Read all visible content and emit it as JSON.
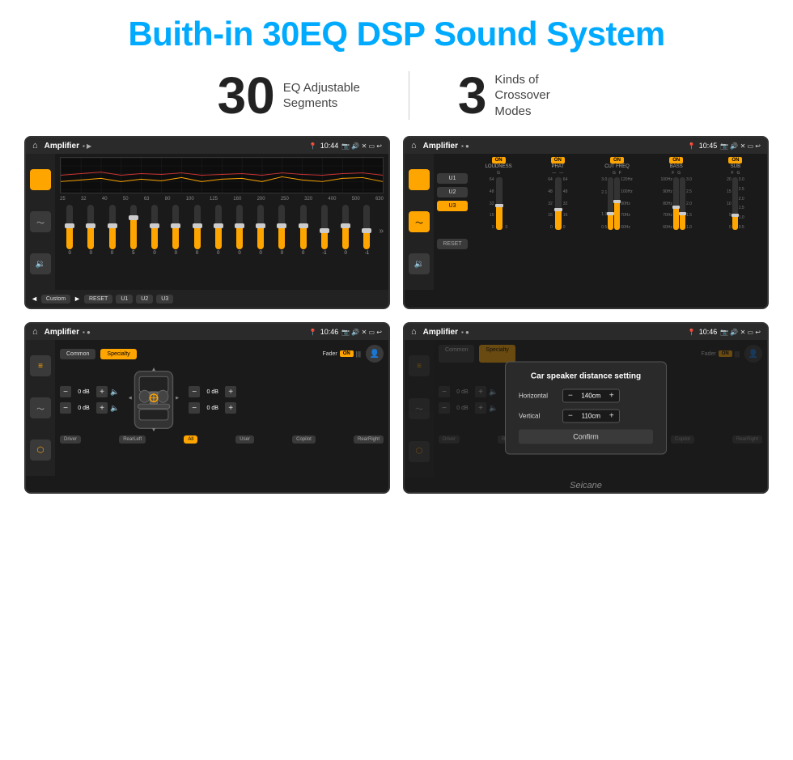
{
  "header": {
    "title": "Buith-in 30EQ DSP Sound System"
  },
  "stats": [
    {
      "number": "30",
      "label": "EQ Adjustable\nSegments"
    },
    {
      "number": "3",
      "label": "Kinds of\nCrossover Modes"
    }
  ],
  "screen1": {
    "status": {
      "title": "Amplifier",
      "time": "10:44"
    },
    "freqs": [
      "25",
      "32",
      "40",
      "50",
      "63",
      "80",
      "100",
      "125",
      "160",
      "200",
      "250",
      "320",
      "400",
      "500",
      "630"
    ],
    "vals": [
      "0",
      "0",
      "0",
      "5",
      "0",
      "0",
      "0",
      "0",
      "0",
      "0",
      "0",
      "0",
      "-1",
      "0",
      "-1"
    ],
    "sliderHeights": [
      50,
      50,
      50,
      60,
      50,
      50,
      50,
      50,
      50,
      50,
      50,
      50,
      42,
      50,
      42
    ],
    "thumbPositions": [
      50,
      50,
      50,
      40,
      50,
      50,
      50,
      50,
      50,
      50,
      50,
      50,
      56,
      50,
      56
    ],
    "buttons": [
      "Custom",
      "RESET",
      "U1",
      "U2",
      "U3"
    ]
  },
  "screen2": {
    "status": {
      "title": "Amplifier",
      "time": "10:45"
    },
    "presets": [
      "U1",
      "U2",
      "U3"
    ],
    "activePreset": "U3",
    "channels": [
      {
        "name": "LOUDNESS",
        "on": true,
        "labels": [
          "G"
        ],
        "vals": [
          "64",
          "48",
          "32",
          "16",
          "0"
        ]
      },
      {
        "name": "PHAT",
        "on": true,
        "labels": [
          "G"
        ],
        "vals": [
          "64",
          "48",
          "32",
          "16",
          "0"
        ]
      },
      {
        "name": "CUT FREQ",
        "on": true,
        "labels": [
          "G",
          "F"
        ],
        "vals": [
          "3.0",
          "2.1",
          "",
          "1.3",
          "0.5"
        ]
      },
      {
        "name": "BASS",
        "on": true,
        "labels": [
          "F",
          "G"
        ],
        "vals": [
          "100Hz",
          "90Hz",
          "80Hz",
          "70Hz",
          "60Hz"
        ]
      },
      {
        "name": "SUB",
        "on": true,
        "labels": [
          "F",
          "G"
        ],
        "vals": [
          "3.0",
          "2.5",
          "2.0",
          "1.5",
          "1.0",
          "0.5"
        ]
      }
    ],
    "resetLabel": "RESET"
  },
  "screen3": {
    "status": {
      "title": "Amplifier",
      "time": "10:46"
    },
    "tabs": [
      "Common",
      "Specialty"
    ],
    "activeTab": "Specialty",
    "faderLabel": "Fader",
    "faderOn": "ON",
    "volumeRows": [
      {
        "val": "0 dB",
        "side": "left"
      },
      {
        "val": "0 dB",
        "side": "left"
      },
      {
        "val": "0 dB",
        "side": "right"
      },
      {
        "val": "0 dB",
        "side": "right"
      }
    ],
    "positions": [
      "Driver",
      "RearLeft",
      "All",
      "User",
      "Copilot",
      "RearRight"
    ],
    "activePosition": "All"
  },
  "screen4": {
    "status": {
      "title": "Amplifier",
      "time": "10:46"
    },
    "tabs": [
      "Common",
      "Specialty"
    ],
    "activeTab": "Specialty",
    "dialog": {
      "title": "Car speaker distance setting",
      "rows": [
        {
          "label": "Horizontal",
          "value": "140cm"
        },
        {
          "label": "Vertical",
          "value": "110cm"
        }
      ],
      "confirmLabel": "Confirm"
    },
    "positions": [
      "Driver",
      "RearLeft",
      "All",
      "User",
      "Copilot",
      "RearRight"
    ]
  },
  "footer": {
    "logo": "Seicane"
  }
}
